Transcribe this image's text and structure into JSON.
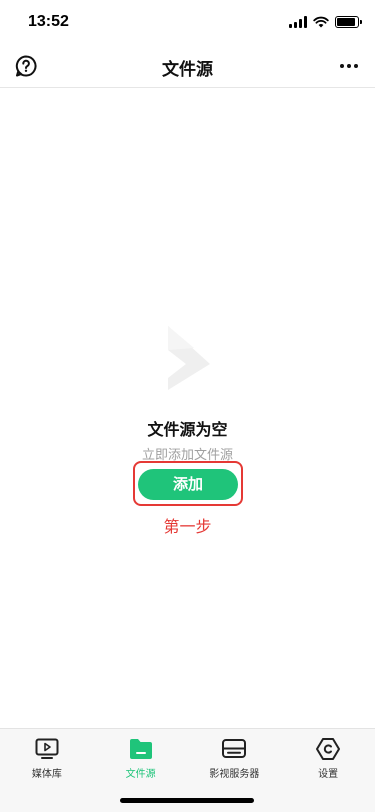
{
  "status_bar": {
    "time": "13:52",
    "battery_level": 0.9
  },
  "nav": {
    "title": "文件源",
    "left_icon": "help-icon",
    "right_icon": "more-icon"
  },
  "empty_state": {
    "title": "文件源为空",
    "subtitle": "立即添加文件源",
    "add_button_label": "添加",
    "annotation_label": "第一步",
    "annotation_color": "#e53935"
  },
  "tabs": [
    {
      "label": "媒体库",
      "icon": "play-screen-icon",
      "active": false
    },
    {
      "label": "文件源",
      "icon": "folder-icon",
      "active": true
    },
    {
      "label": "影视服务器",
      "icon": "server-icon",
      "active": false
    },
    {
      "label": "设置",
      "icon": "settings-hexagon-icon",
      "active": false
    }
  ],
  "colors": {
    "accent": "#1fc47a",
    "annotation": "#e53935"
  }
}
